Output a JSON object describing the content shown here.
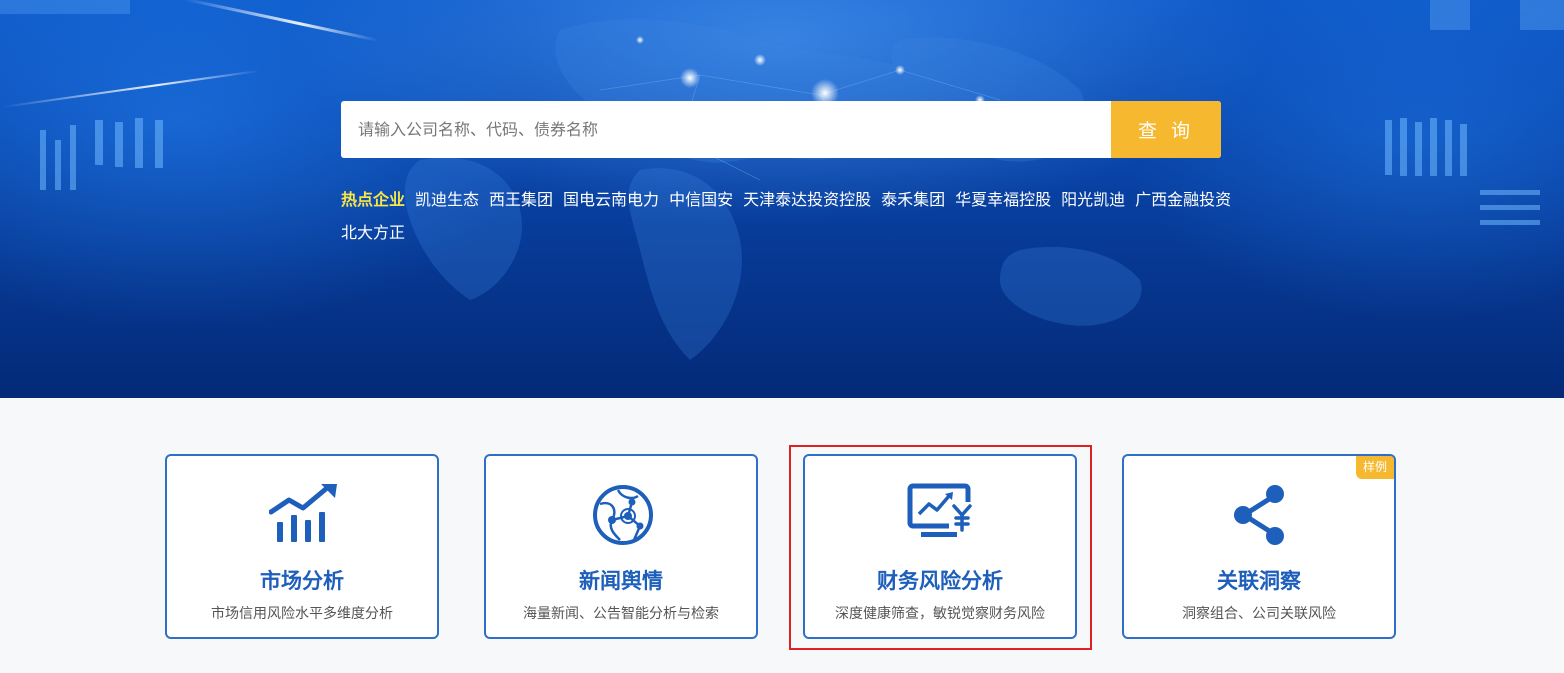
{
  "search": {
    "placeholder": "请输入公司名称、代码、债券名称",
    "button_label": "查 询"
  },
  "hot": {
    "label": "热点企业",
    "companies": [
      "凯迪生态",
      "西王集团",
      "国电云南电力",
      "中信国安",
      "天津泰达投资控股",
      "泰禾集团",
      "华夏幸福控股",
      "阳光凯迪",
      "广西金融投资",
      "北大方正"
    ]
  },
  "cards": [
    {
      "title": "市场分析",
      "desc": "市场信用风险水平多维度分析",
      "icon": "chart-trend-icon"
    },
    {
      "title": "新闻舆情",
      "desc": "海量新闻、公告智能分析与检索",
      "icon": "globe-network-icon"
    },
    {
      "title": "财务风险分析",
      "desc": "深度健康筛查，敏锐觉察财务风险",
      "icon": "monitor-yuan-icon"
    },
    {
      "title": "关联洞察",
      "desc": "洞察组合、公司关联风险",
      "icon": "share-icon",
      "badge": "样例"
    }
  ],
  "colors": {
    "accent": "#f5b82e",
    "card_border": "#2f6fc7",
    "card_title": "#1d5fba",
    "hot_label": "#f7e54a",
    "highlight": "#e02121"
  }
}
